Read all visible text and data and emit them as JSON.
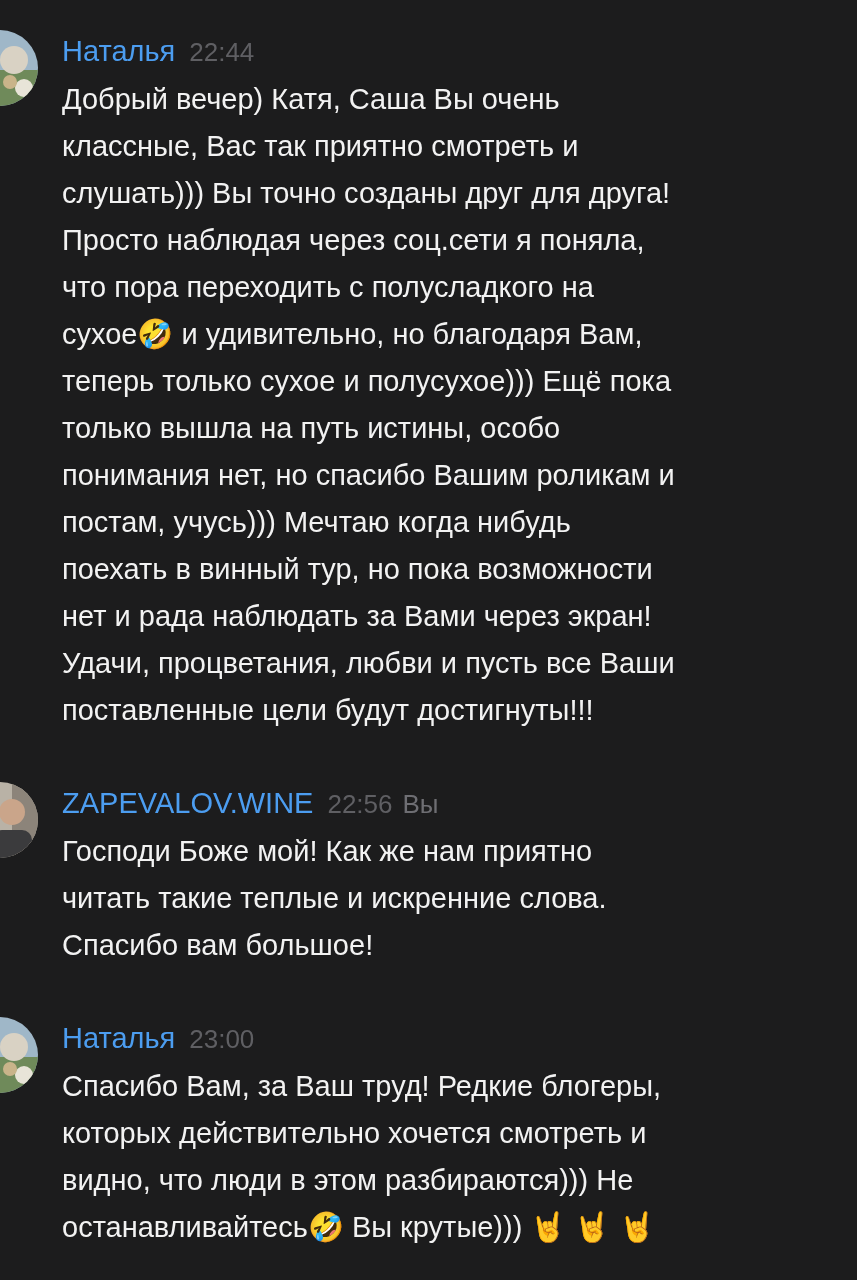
{
  "messages": [
    {
      "author": "Наталья",
      "time": "22:44",
      "text": "Добрый вечер) Катя, Саша Вы очень\nклассные, Вас так приятно смотреть и\nслушать))) Вы точно созданы друг для друга!\nПросто наблюдая через соц.сети я поняла,\nчто пора переходить с полусладкого на\nсухое🤣 и удивительно, но благодаря Вам,\nтеперь только сухое и полусухое))) Ещё пока\nтолько вышла на путь истины, особо\nпонимания нет, но спасибо Вашим роликам и\nпостам, учусь))) Мечтаю когда нибудь\nпоехать в винный тур, но пока возможности\nнет и рада наблюдать за Вами через экран!\nУдачи, процветания, любви и пусть все Ваши\nпоставленные цели будут достигнуты!!!"
    },
    {
      "author": "ZAPEVALOV.WINE",
      "time": "22:56",
      "own_label": "Вы",
      "text": "Господи Боже мой! Как же нам приятно\nчитать такие теплые и искренние слова.\nСпасибо вам большое!"
    },
    {
      "author": "Наталья",
      "time": "23:00",
      "text": "Спасибо Вам, за Ваш труд! Редкие блогеры,\nкоторых действительно хочется смотреть и\nвидно, что люди в этом разбираются))) Не\nостанавливайтесь🤣 Вы крутые))) 🤘 🤘 🤘"
    }
  ]
}
